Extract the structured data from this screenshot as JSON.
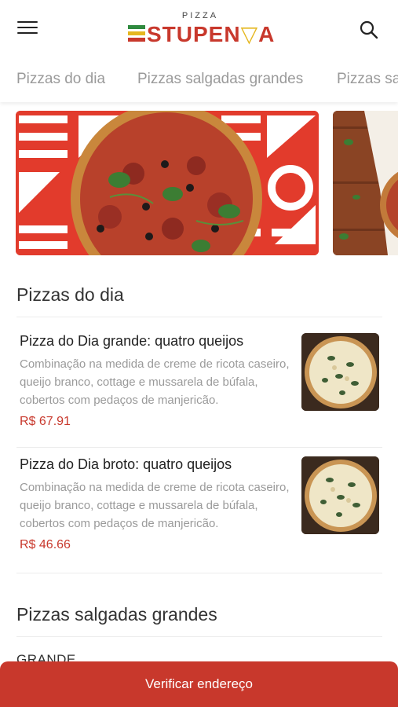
{
  "header": {
    "logo_small": "PIZZA",
    "logo_main_a": "STU",
    "logo_main_b": "PEN",
    "logo_main_c": "A",
    "menu_icon": "hamburger-menu-icon",
    "search_icon": "search-icon"
  },
  "tabs": [
    {
      "label": "Pizzas do dia"
    },
    {
      "label": "Pizzas salgadas grandes"
    },
    {
      "label": "Pizzas sa"
    }
  ],
  "colors": {
    "brand_red": "#c8382c",
    "brand_green": "#2f8a3f",
    "brand_yellow": "#e5b720",
    "banner_red": "#e23b2c"
  },
  "sections": [
    {
      "title": "Pizzas do dia",
      "items": [
        {
          "name": "Pizza do Dia grande: quatro queijos",
          "description": "Combinação na medida de creme de ricota caseiro, queijo branco, cottage e mussarela de búfala, cobertos com pedaços de manjericão.",
          "price": "R$ 67.91"
        },
        {
          "name": "Pizza do Dia broto: quatro queijos",
          "description": "Combinação na medida de creme de ricota caseiro, queijo branco, cottage e mussarela de búfala, cobertos com pedaços de manjericão.",
          "price": "R$ 46.66"
        }
      ]
    },
    {
      "title": "Pizzas salgadas grandes",
      "subheading": "GRANDE"
    }
  ],
  "cta": {
    "label": "Verificar endereço"
  }
}
